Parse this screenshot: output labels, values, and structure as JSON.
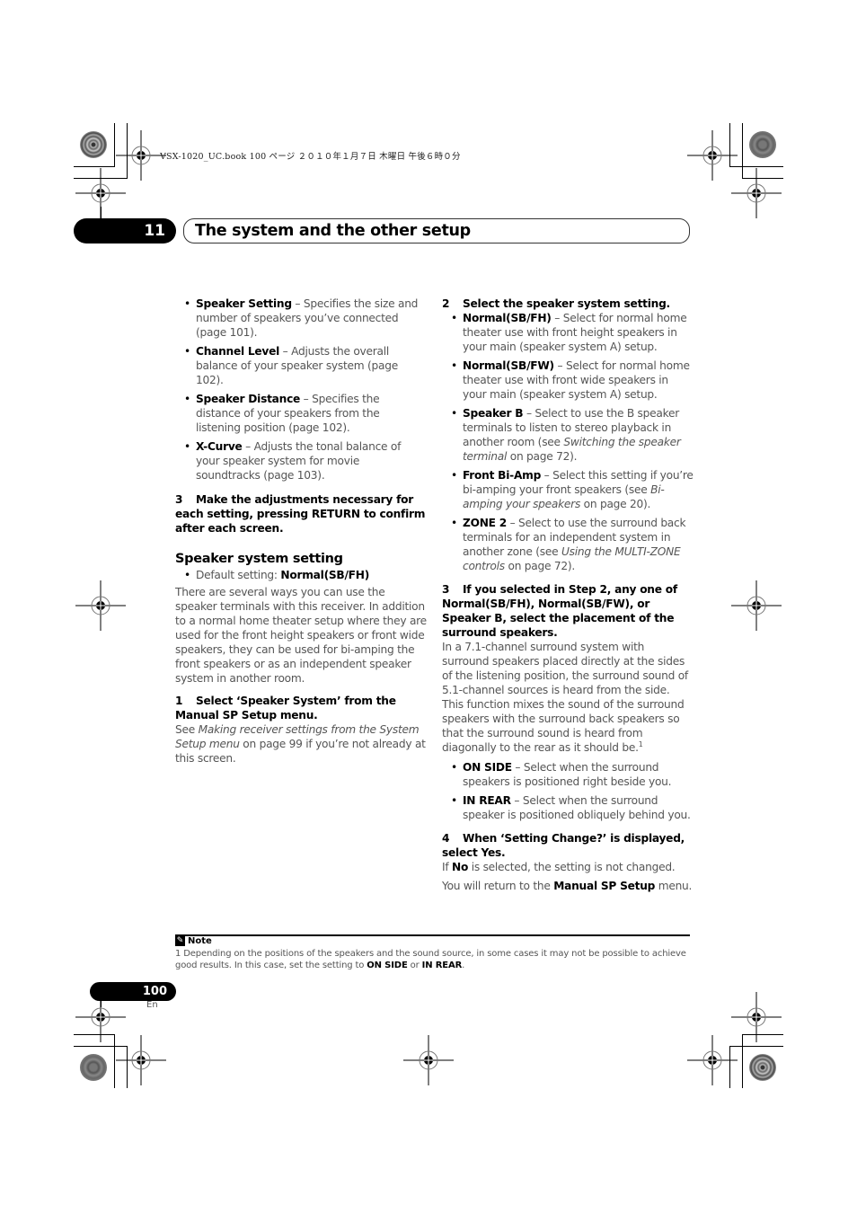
{
  "print_header": {
    "text": "VSX-1020_UC.book   100 ページ   ２０１０年１月７日   木曜日   午後６時０分"
  },
  "chapter": {
    "number": "11",
    "title": "The system and the other setup"
  },
  "left_column": {
    "menu_items": [
      {
        "term": "Speaker Setting",
        "desc": " – Specifies the size and number of speakers you’ve connected (page 101)."
      },
      {
        "term": "Channel Level",
        "desc": " – Adjusts the overall balance of your speaker system (page 102)."
      },
      {
        "term": "Speaker Distance",
        "desc": " – Specifies the distance of your speakers from the listening position (page 102)."
      },
      {
        "term": "X-Curve",
        "desc": " – Adjusts the tonal balance of your speaker system for movie soundtracks (page 103)."
      }
    ],
    "step3": {
      "num": "3",
      "text": "Make the adjustments necessary for each setting, pressing RETURN to confirm after each screen."
    },
    "section": {
      "heading": "Speaker system setting",
      "default_label": "Default setting: ",
      "default_value": "Normal(SB/FH)",
      "intro": "There are several ways you can use the speaker terminals with this receiver. In addition to a normal home theater setup where they are used for the front height speakers or front wide speakers, they can be used for bi-amping the front speakers or as an independent speaker system in another room."
    },
    "step1": {
      "num": "1",
      "text": "Select ‘Speaker System’ from the Manual SP Setup menu.",
      "body_pre": "See ",
      "body_link": "Making receiver settings from the System Setup menu",
      "body_post": " on page 99 if you’re not already at this screen."
    }
  },
  "right_column": {
    "step2": {
      "num": "2",
      "text": "Select the speaker system setting."
    },
    "options": [
      {
        "term": "Normal(SB/FH)",
        "desc": " – Select for normal home theater use with front height speakers in your main (speaker system A) setup.",
        "ref": "",
        "post": ""
      },
      {
        "term": "Normal(SB/FW)",
        "desc": " – Select for normal home theater use with front wide speakers in your main (speaker system A) setup.",
        "ref": "",
        "post": ""
      },
      {
        "term": "Speaker B",
        "desc": " – Select to use the B speaker terminals to listen to stereo playback in another room (see ",
        "ref": "Switching the speaker terminal",
        "post": " on page 72)."
      },
      {
        "term": "Front Bi-Amp",
        "desc": " – Select this setting if you’re bi-amping your front speakers (see ",
        "ref": "Bi-amping your speakers",
        "post": " on page 20)."
      },
      {
        "term": "ZONE 2",
        "desc": " – Select to use the surround back terminals for an independent system in another zone (see ",
        "ref": "Using the MULTI-ZONE controls",
        "post": " on page 72)."
      }
    ],
    "step3": {
      "num": "3",
      "text": "If you selected in Step 2, any one of Normal(SB/FH), Normal(SB/FW), or Speaker B, select the placement of the surround speakers.",
      "body": "In a 7.1-channel surround system with surround speakers placed directly at the sides of the listening position, the surround sound of 5.1-channel sources is heard from the side. This function mixes the sound of the surround speakers with the surround back speakers so that the surround sound is heard from diagonally to the rear as it should be.",
      "footnote_ref": "1"
    },
    "placement_options": [
      {
        "term": "ON SIDE",
        "desc": " – Select when the surround speakers is positioned right beside you."
      },
      {
        "term": "IN REAR",
        "desc": " – Select when the surround speaker is positioned obliquely behind you."
      }
    ],
    "step4": {
      "num": "4",
      "text": "When ‘Setting Change?’ is displayed, select Yes.",
      "line1_pre": "If ",
      "line1_bold": "No",
      "line1_post": " is selected, the setting is not changed.",
      "line2_pre": "You will return to the ",
      "line2_bold": "Manual SP Setup",
      "line2_post": " menu."
    }
  },
  "note": {
    "icon": "pencil-note-icon",
    "heading": "Note",
    "text_pre": "1 Depending on the positions of the speakers and the sound source, in some cases it may not be possible to achieve good results. In this case, set the setting to ",
    "bold1": "ON SIDE",
    "mid": " or ",
    "bold2": "IN REAR",
    "end": "."
  },
  "footer": {
    "page_number": "100",
    "language": "En"
  }
}
